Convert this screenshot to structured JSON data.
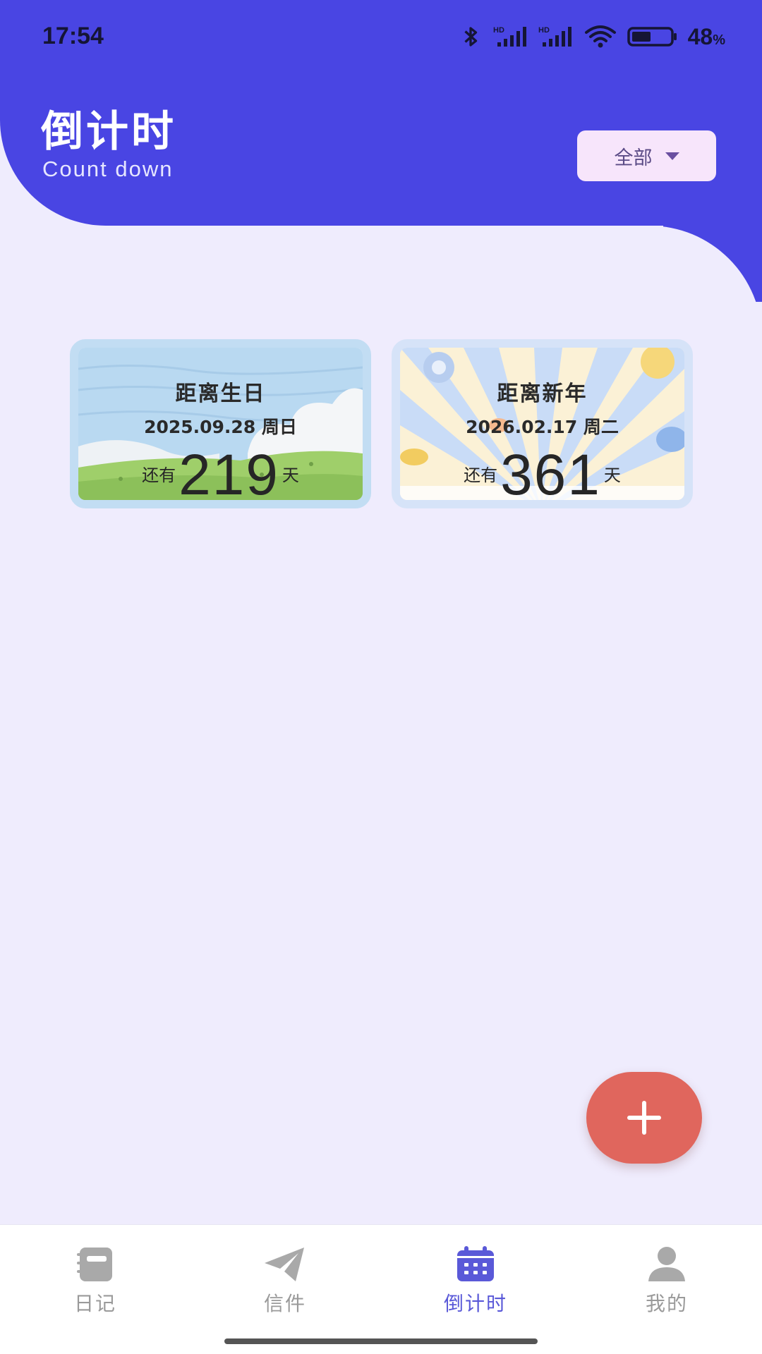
{
  "status_bar": {
    "time": "17:54",
    "battery_level": "48",
    "battery_unit": "%",
    "icons": [
      "bluetooth-icon",
      "hd-signal-icon",
      "hd-signal-icon",
      "wifi-icon",
      "battery-icon"
    ]
  },
  "header": {
    "title": "倒计时",
    "subtitle": "Count down",
    "filter_label": "全部",
    "colors": {
      "header_bg": "#4945e3",
      "filter_bg": "#f7e5fb"
    }
  },
  "countdowns": [
    {
      "title": "距离生日",
      "date": "2025.09.28 周日",
      "prefix": "还有",
      "days": "219",
      "suffix": "天"
    },
    {
      "title": "距离新年",
      "date": "2026.02.17 周二",
      "prefix": "还有",
      "days": "361",
      "suffix": "天"
    }
  ],
  "fab": {
    "icon": "plus-icon",
    "color": "#e0665d"
  },
  "nav": {
    "items": [
      {
        "label": "日记",
        "icon": "notebook-icon",
        "active": false
      },
      {
        "label": "信件",
        "icon": "paper-plane-icon",
        "active": false
      },
      {
        "label": "倒计时",
        "icon": "calendar-icon",
        "active": true
      },
      {
        "label": "我的",
        "icon": "person-icon",
        "active": false
      }
    ],
    "active_color": "#5a59d8",
    "inactive_color": "#9a9a9a"
  }
}
